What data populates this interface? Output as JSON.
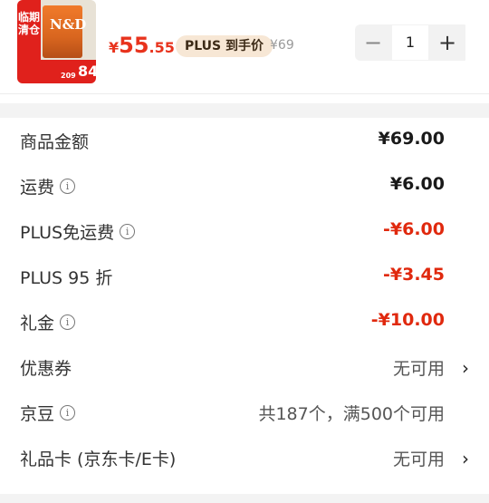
{
  "product": {
    "thumb_banner": "临期清仓",
    "thumb_price_small": "209",
    "thumb_price_big": "84",
    "thumb_brand": "N&D",
    "price_yen": "¥",
    "price_int": "55",
    "price_dec": ".55",
    "plus_tag": "PLUS 到手价",
    "original_price": "¥69",
    "quantity": "1",
    "minus_symbol": "−",
    "plus_symbol": "+"
  },
  "rows": [
    {
      "label": "商品金额",
      "value": "¥69.00"
    },
    {
      "label": "运费",
      "value": "¥6.00"
    },
    {
      "label": "PLUS免运费",
      "value": "-¥6.00"
    },
    {
      "label": "PLUS 95 折",
      "value": "-¥3.45"
    },
    {
      "label": "礼金",
      "value": "-¥10.00"
    },
    {
      "label": "优惠券",
      "value": "无可用"
    },
    {
      "label": "京豆",
      "value": "共187个，满500个可用"
    },
    {
      "label": "礼品卡 (京东卡/E卡)",
      "value": "无可用"
    }
  ],
  "icons": {
    "info": "info-circle-icon",
    "chevron": "chevron-right-icon"
  },
  "colors": {
    "price_red": "#e8331d",
    "discount_red": "#e0290e",
    "plus_tag_bg": "#f7e7d5"
  }
}
